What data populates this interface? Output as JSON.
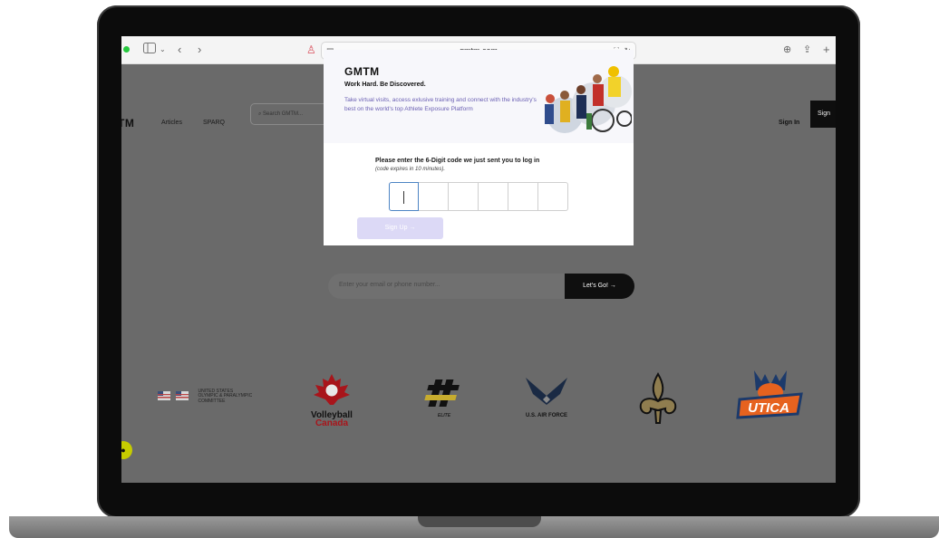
{
  "browser": {
    "url": "gmtm.com",
    "icons": [
      "sidebar-icon",
      "chevron-down-icon",
      "back-icon",
      "forward-icon",
      "privacy-icon",
      "reader-icon",
      "translate-icon",
      "reload-icon",
      "download-icon",
      "share-icon",
      "new-tab-icon"
    ]
  },
  "site": {
    "logo": "TM",
    "nav": {
      "articles": "Articles",
      "sparq": "SPARQ",
      "search_placeholder": "Search GMTM...",
      "signin": "Sign In",
      "signup": "Sign"
    },
    "email_placeholder": "Enter your email or phone number...",
    "lets_go": "Let's Go! →",
    "partners": {
      "usopc": [
        "UNITED STATES",
        "OLYMPIC & PARALYMPIC",
        "COMMITTEE"
      ],
      "volleyball": [
        "Volleyball",
        "Canada"
      ],
      "elite": "ELITE",
      "airforce": "U.S. AIR FORCE",
      "utica": "UTICA"
    }
  },
  "modal": {
    "logo": "GMTM",
    "tagline": "Work Hard. Be Discovered.",
    "description": "Take virtual visits, access exlusive training and connect with the industry's best on the world's top Athlete Exposure Platform",
    "prompt": "Please enter the 6-Digit code we just sent you to log in",
    "expires": "(code expires in 10 minutes).",
    "code_digits": [
      "",
      "",
      "",
      "",
      "",
      ""
    ],
    "signup_button": "Sign Up →"
  }
}
